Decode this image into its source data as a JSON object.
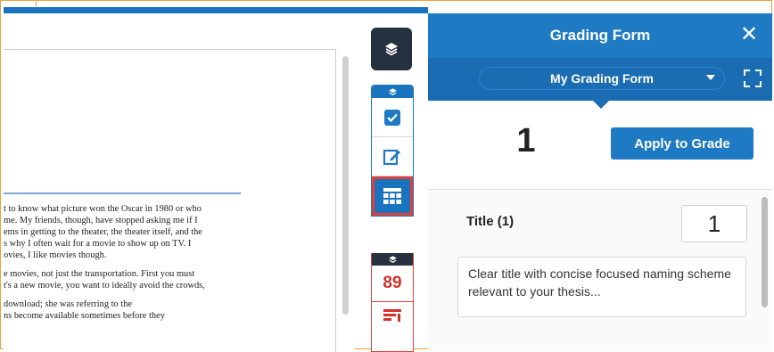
{
  "document": {
    "lines_a": [
      "t to know what picture won the Oscar in 1980 or who",
      " me. My friends, though, have stopped asking me if I",
      "ems in getting to the theater, the theater itself, and the",
      "s why I often wait for a movie to show up on TV.  I",
      "ovies, I like movies though."
    ],
    "lines_b": [
      "e movies, not just the transportation.  First you must",
      "t's a new movie, you want to ideally avoid the crowds,"
    ],
    "lines_c": [
      "download; she was referring to the",
      "ns become available sometimes before they"
    ]
  },
  "toolbar": {
    "layers_icon": "layers-icon",
    "checklist_icon": "checkbox-icon",
    "edit_icon": "edit-icon",
    "grid_icon": "grid-icon",
    "score_value": "89",
    "report_icon": "report-icon"
  },
  "panel": {
    "title": "Grading Form",
    "close_label": "✕",
    "form_selected": "My Grading Form",
    "total_score": "1",
    "apply_label": "Apply to Grade",
    "criterion": {
      "title": "Title (1)",
      "score": "1",
      "description": "Clear title with concise focused naming scheme relevant to your thesis..."
    }
  },
  "colors": {
    "brand_blue": "#1f7ac4",
    "dark_navy": "#26313f",
    "highlight_red": "#e0413a",
    "frame_orange": "#e8a33d"
  }
}
